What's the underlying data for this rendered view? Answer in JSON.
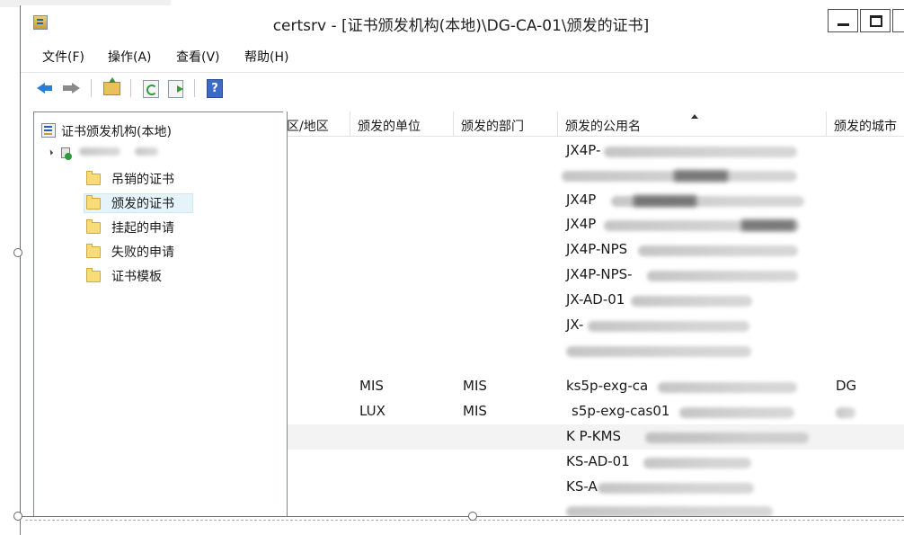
{
  "window": {
    "title": "certsrv - [证书颁发机构(本地)\\DG-CA-01\\颁发的证书]"
  },
  "menu": {
    "items": [
      "文件(F)",
      "操作(A)",
      "查看(V)",
      "帮助(H)"
    ]
  },
  "toolbar": {
    "buttons": [
      {
        "icon": "back-arrow-icon",
        "enabled": true
      },
      {
        "icon": "forward-arrow-icon",
        "enabled": false
      },
      {
        "icon": "up-folder-icon",
        "enabled": true
      },
      {
        "icon": "refresh-icon",
        "enabled": true
      },
      {
        "icon": "export-list-icon",
        "enabled": true
      },
      {
        "icon": "help-icon",
        "enabled": true
      }
    ]
  },
  "tree": {
    "root": "证书颁发机构(本地)",
    "ca_node": "",
    "children": [
      {
        "label": "吊销的证书",
        "selected": false
      },
      {
        "label": "颁发的证书",
        "selected": true
      },
      {
        "label": "挂起的申请",
        "selected": false
      },
      {
        "label": "失败的申请",
        "selected": false
      },
      {
        "label": "证书模板",
        "selected": false
      }
    ]
  },
  "list": {
    "columns": [
      "区/地区",
      "颁发的单位",
      "颁发的部门",
      "颁发的公用名",
      "颁发的城市"
    ],
    "sorted_column": "颁发的公用名",
    "rows": [
      {
        "region": "",
        "org": "",
        "dept": "",
        "cn": "JX4P-",
        "city": ""
      },
      {
        "region": "",
        "org": "",
        "dept": "",
        "cn": "",
        "city": ""
      },
      {
        "region": "",
        "org": "",
        "dept": "",
        "cn": "JX4P",
        "city": ""
      },
      {
        "region": "",
        "org": "",
        "dept": "",
        "cn": "JX4P",
        "city": ""
      },
      {
        "region": "",
        "org": "",
        "dept": "",
        "cn": "JX4P-NPS",
        "city": ""
      },
      {
        "region": "",
        "org": "",
        "dept": "",
        "cn": "JX4P-NPS-",
        "city": ""
      },
      {
        "region": "",
        "org": "",
        "dept": "",
        "cn": "JX-AD-01",
        "city": ""
      },
      {
        "region": "",
        "org": "",
        "dept": "",
        "cn": "JX-",
        "city": ""
      },
      {
        "region": "",
        "org": "",
        "dept": "",
        "cn": "",
        "city": ""
      },
      {
        "region": "",
        "org": "MIS",
        "dept": "MIS",
        "cn": "ks5p-exg-ca",
        "city": "DG"
      },
      {
        "region": "",
        "org": "LUX",
        "dept": "MIS",
        "cn": "s5p-exg-cas01",
        "city": ""
      },
      {
        "region": "",
        "org": "",
        "dept": "",
        "cn": "K P-KMS",
        "city": ""
      },
      {
        "region": "",
        "org": "",
        "dept": "",
        "cn": "KS-AD-01",
        "city": ""
      },
      {
        "region": "",
        "org": "",
        "dept": "",
        "cn": "KS-A",
        "city": ""
      },
      {
        "region": "",
        "org": "",
        "dept": "",
        "cn": "",
        "city": ""
      }
    ]
  }
}
